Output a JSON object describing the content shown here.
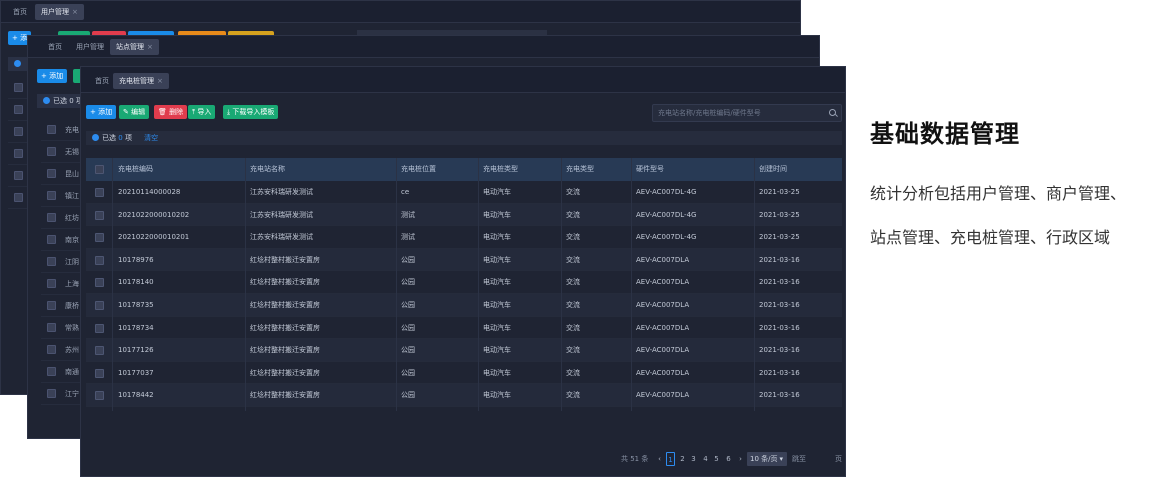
{
  "back_window_1": {
    "tabs": [
      {
        "label": "首页"
      },
      {
        "label": "用户管理"
      }
    ],
    "close_glyph": "×",
    "add_label": "+ 添"
  },
  "back_window_2": {
    "tabs": [
      {
        "label": "首页"
      },
      {
        "label": "用户管理"
      },
      {
        "label": "站点管理"
      }
    ],
    "add_label": "+ 添加",
    "selected_label": "已选 0 项",
    "rows": [
      "充电",
      "无锡",
      "昆山",
      "镇江",
      "红坊",
      "南京",
      "江阴",
      "上海",
      "康桥",
      "常熟",
      "苏州",
      "南通",
      "江宁"
    ]
  },
  "front_window": {
    "tabs": [
      {
        "label": "首页"
      },
      {
        "label": "充电桩管理"
      }
    ],
    "toolbar": {
      "add": "+ 添加",
      "edit": "编辑",
      "delete": "删除",
      "import": "导入",
      "download_template": "下载导入模板"
    },
    "search": {
      "placeholder": "充电站名称/充电桩编码/硬件型号"
    },
    "selection": {
      "prefix": "已选",
      "count": "0",
      "suffix": "项",
      "clear": "清空"
    },
    "table": {
      "columns": [
        "充电桩编码",
        "充电站名称",
        "充电桩位置",
        "充电桩类型",
        "充电类型",
        "硬件型号",
        "创建时间"
      ],
      "rows": [
        [
          "20210114000028",
          "江苏安科瑞研发测试",
          "ce",
          "电动汽车",
          "交流",
          "AEV-AC007DL-4G",
          "2021-03-25"
        ],
        [
          "2021022000010202",
          "江苏安科瑞研发测试",
          "测试",
          "电动汽车",
          "交流",
          "AEV-AC007DL-4G",
          "2021-03-25"
        ],
        [
          "2021022000010201",
          "江苏安科瑞研发测试",
          "测试",
          "电动汽车",
          "交流",
          "AEV-AC007DL-4G",
          "2021-03-25"
        ],
        [
          "10178976",
          "红埝村整村搬迁安置房",
          "公园",
          "电动汽车",
          "交流",
          "AEV-AC007DLA",
          "2021-03-16"
        ],
        [
          "10178140",
          "红埝村整村搬迁安置房",
          "公园",
          "电动汽车",
          "交流",
          "AEV-AC007DLA",
          "2021-03-16"
        ],
        [
          "10178735",
          "红埝村整村搬迁安置房",
          "公园",
          "电动汽车",
          "交流",
          "AEV-AC007DLA",
          "2021-03-16"
        ],
        [
          "10178734",
          "红埝村整村搬迁安置房",
          "公园",
          "电动汽车",
          "交流",
          "AEV-AC007DLA",
          "2021-03-16"
        ],
        [
          "10177126",
          "红埝村整村搬迁安置房",
          "公园",
          "电动汽车",
          "交流",
          "AEV-AC007DLA",
          "2021-03-16"
        ],
        [
          "10177037",
          "红埝村整村搬迁安置房",
          "公园",
          "电动汽车",
          "交流",
          "AEV-AC007DLA",
          "2021-03-16"
        ],
        [
          "10178442",
          "红埝村整村搬迁安置房",
          "公园",
          "电动汽车",
          "交流",
          "AEV-AC007DLA",
          "2021-03-16"
        ]
      ]
    },
    "pagination": {
      "total": "共 51 条",
      "prev": "‹",
      "pages": [
        "1",
        "2",
        "3",
        "4",
        "5",
        "6"
      ],
      "current": "1",
      "next": "›",
      "page_size": "10 条/页",
      "goto_prefix": "跳至",
      "goto_suffix": "页"
    }
  },
  "feature": {
    "title": "基础数据管理",
    "line1": "统计分析包括用户管理、商户管理、",
    "line2": "站点管理、充电桩管理、行政区域"
  },
  "colors": {
    "background": "#1f2433",
    "accent_blue": "#1a8be8",
    "green": "#19a974",
    "red": "#e03c4d",
    "table_header": "#283a55"
  }
}
